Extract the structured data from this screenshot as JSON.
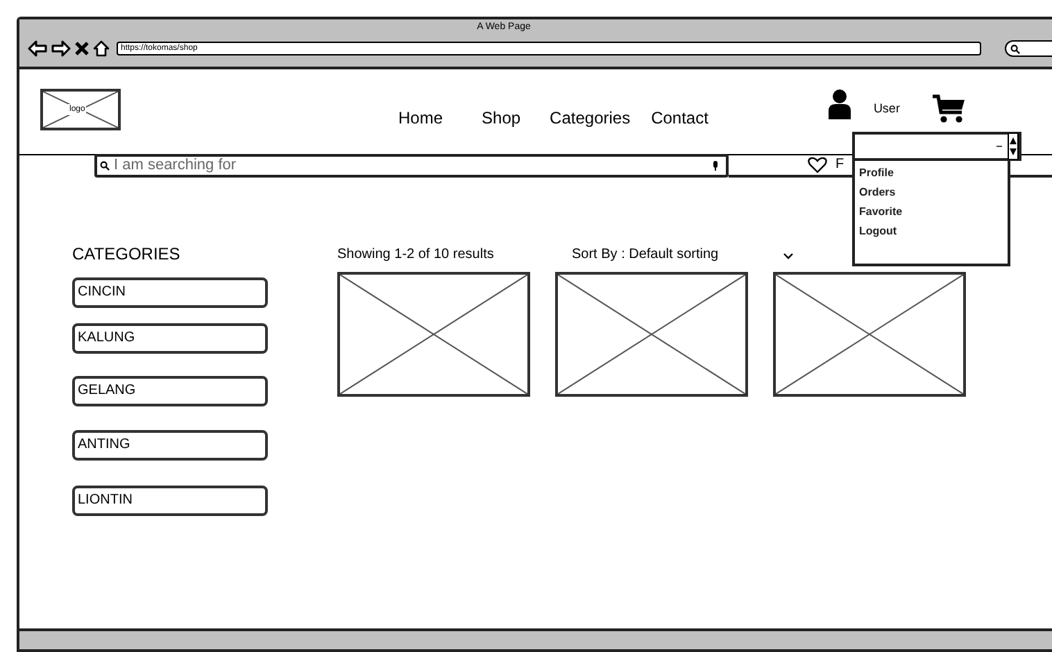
{
  "browser": {
    "title": "A Web Page",
    "url": "https://tokomas/shop"
  },
  "header": {
    "logo": "logo",
    "nav": [
      {
        "label": "Home"
      },
      {
        "label": "Shop"
      },
      {
        "label": "Categories"
      },
      {
        "label": "Contact"
      }
    ],
    "user": {
      "label": "User",
      "menu": [
        {
          "label": "Profile"
        },
        {
          "label": "Orders"
        },
        {
          "label": "Favorite"
        },
        {
          "label": "Logout"
        }
      ]
    }
  },
  "search": {
    "placeholder": "I am searching for",
    "side_label": "F"
  },
  "categories": {
    "title": "CATEGORIES",
    "items": [
      {
        "label": "CINCIN"
      },
      {
        "label": "KALUNG"
      },
      {
        "label": "GELANG"
      },
      {
        "label": "ANTING"
      },
      {
        "label": "LIONTIN"
      }
    ]
  },
  "results": {
    "summary": "Showing 1-2 of 10 results",
    "sort": "Sort By : Default sorting",
    "products": [
      {
        "kind": "image"
      },
      {
        "kind": "image"
      },
      {
        "kind": "image"
      }
    ]
  }
}
